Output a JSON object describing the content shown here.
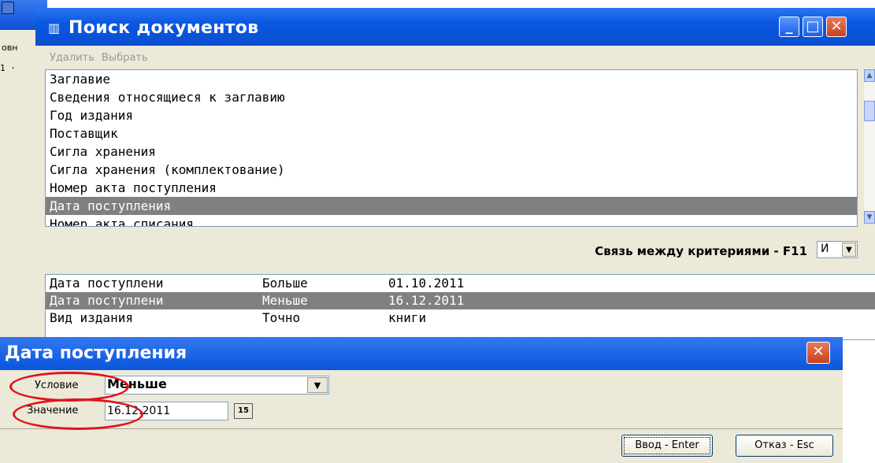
{
  "background_window": {
    "menu_fragment": "овн",
    "row_fragment": "1 ·"
  },
  "main_window": {
    "icon": "book-icon",
    "title": "Поиск документов",
    "controls": [
      "minimize-icon",
      "maximize-icon",
      "close-icon"
    ],
    "menu": {
      "delete_label": "Удалить",
      "select_label": "Выбрать"
    },
    "fields": [
      "Заглавие",
      "Сведения относящиеся к заглавию",
      "Год издания",
      "Поставщик",
      "Сигла хранения",
      "Сигла хранения (комплектование)",
      "Номер акта поступления",
      "Дата поступления",
      "Номер акта списания"
    ],
    "selected_field": "Дата поступления",
    "criteria_link": {
      "label": "Связь между критериями - F11",
      "value": "И"
    },
    "criteria": [
      {
        "field": "Дата поступлени",
        "condition": "Больше",
        "value": "01.10.2011"
      },
      {
        "field": "Дата поступлени",
        "condition": "Меньше",
        "value": "16.12.2011",
        "selected": true
      },
      {
        "field": "Вид издания",
        "condition": "Точно",
        "value": "книги"
      }
    ]
  },
  "date_dialog": {
    "title": "Дата поступления",
    "condition_label": "Условие",
    "condition_value": "Меньше",
    "value_label": "Значение",
    "value": "16.12.2011",
    "calendar_button": "15",
    "ok_button": "Ввод - Enter",
    "cancel_button": "Отказ - Esc"
  },
  "colors": {
    "titlebar": "#0a55dc",
    "selection": "#808080",
    "annotation": "#e0141c",
    "window_bg": "#ece9d8"
  }
}
